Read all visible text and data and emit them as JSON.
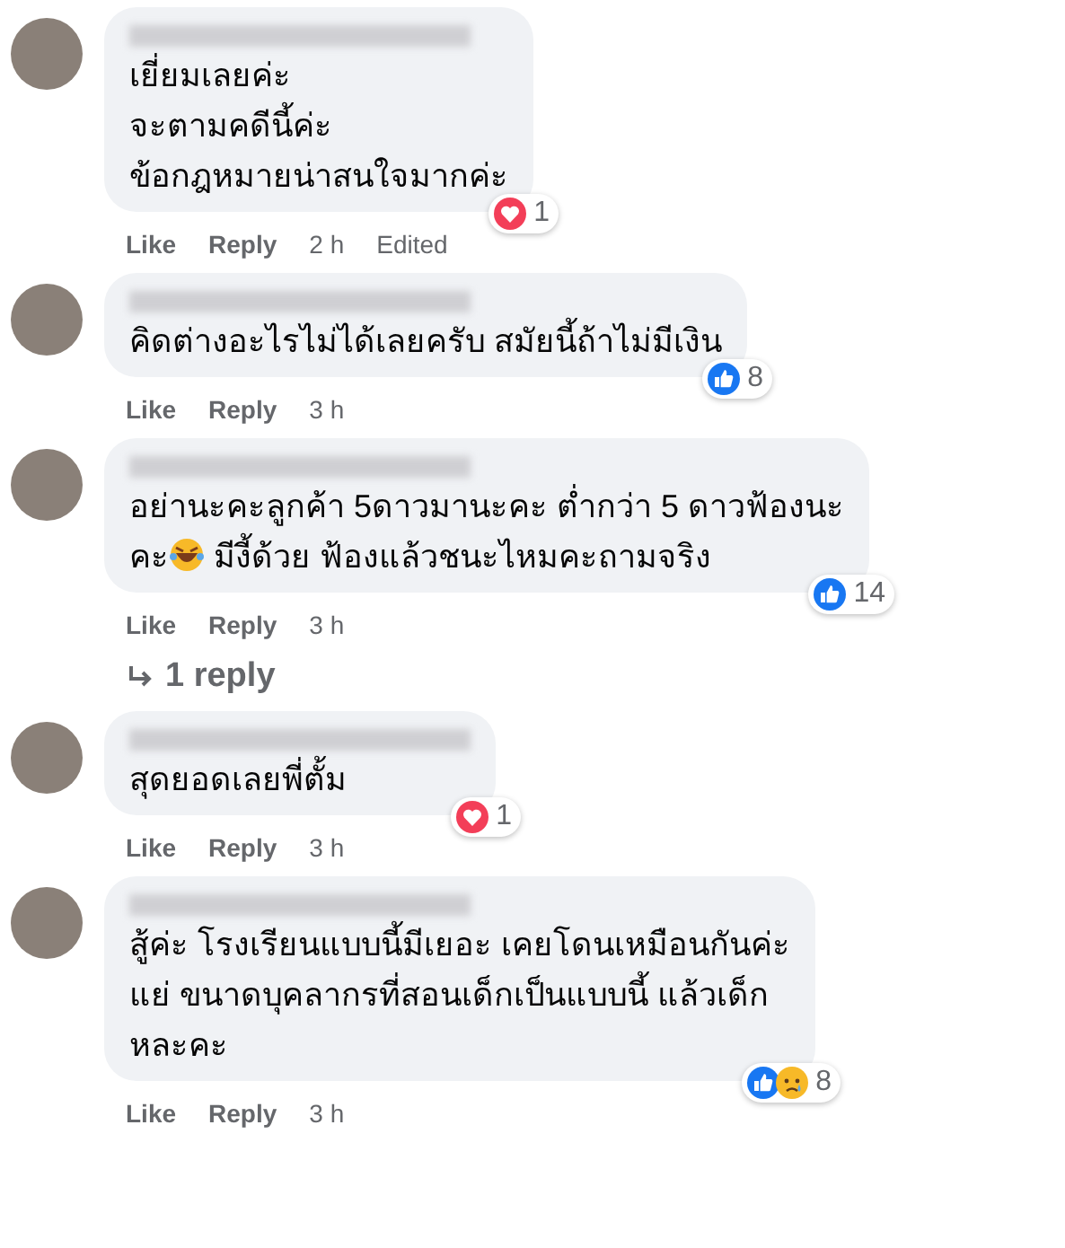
{
  "comments": [
    {
      "lines": [
        [
          {
            "kind": "text",
            "text": "เยี่ยมเลยค่ะ"
          }
        ],
        [
          {
            "kind": "text",
            "text": "จะตามคดีนี้ค่ะ"
          }
        ],
        [
          {
            "kind": "text",
            "text": "ข้อกฎหมายน่าสนใจมากค่ะ"
          }
        ]
      ],
      "actions": {
        "like": "Like",
        "reply": "Reply",
        "time": "2 h",
        "edited": "Edited"
      },
      "reactions": {
        "icons": [
          {
            "kind": "love"
          }
        ],
        "count": "1"
      }
    },
    {
      "lines": [
        [
          {
            "kind": "text",
            "text": "คิดต่างอะไรไม่ได้เลยครับ สมัยนี้ถ้าไม่มีเงิน"
          }
        ]
      ],
      "actions": {
        "like": "Like",
        "reply": "Reply",
        "time": "3 h"
      },
      "reactions": {
        "icons": [
          {
            "kind": "like"
          }
        ],
        "count": "8"
      }
    },
    {
      "lines": [
        [
          {
            "kind": "text",
            "text": "อย่านะคะลูกค้า 5ดาวมานะคะ ต่ำกว่า 5 ดาวฟ้องนะ"
          }
        ],
        [
          {
            "kind": "text",
            "text": "คะ"
          },
          {
            "kind": "emoji"
          },
          {
            "kind": "text",
            "text": " มีงี้ด้วย ฟ้องแล้วชนะไหมคะถามจริง"
          }
        ]
      ],
      "actions": {
        "like": "Like",
        "reply": "Reply",
        "time": "3 h"
      },
      "reactions": {
        "icons": [
          {
            "kind": "like"
          }
        ],
        "count": "14"
      },
      "replies_link": "1 reply"
    },
    {
      "lines": [
        [
          {
            "kind": "text",
            "text": "สุดยอดเลยพี่ตั้ม"
          }
        ]
      ],
      "actions": {
        "like": "Like",
        "reply": "Reply",
        "time": "3 h"
      },
      "reactions": {
        "icons": [
          {
            "kind": "love"
          }
        ],
        "count": "1"
      }
    },
    {
      "lines": [
        [
          {
            "kind": "text",
            "text": "สู้ค่ะ โรงเรียนแบบนี้มีเยอะ เคยโดนเหมือนกันค่ะ"
          }
        ],
        [
          {
            "kind": "text",
            "text": "แย่ ขนาดบุคลากรที่สอนเด็กเป็นแบบนี้ แล้วเด็ก"
          }
        ],
        [
          {
            "kind": "text",
            "text": "หละคะ"
          }
        ]
      ],
      "actions": {
        "like": "Like",
        "reply": "Reply",
        "time": "3 h"
      },
      "reactions": {
        "icons": [
          {
            "kind": "like"
          },
          {
            "kind": "sad"
          }
        ],
        "count": "8"
      }
    }
  ]
}
